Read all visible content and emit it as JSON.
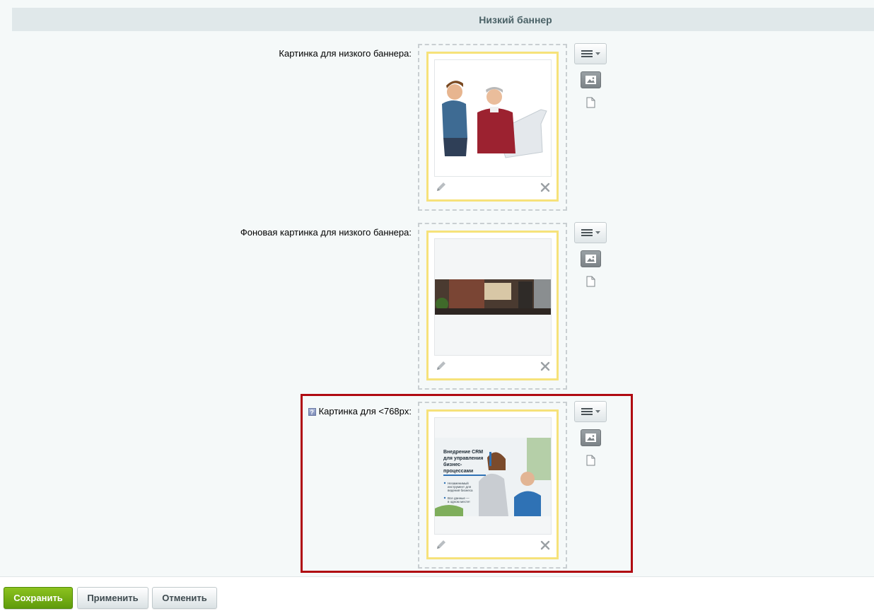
{
  "section": {
    "title": "Низкий баннер"
  },
  "fields": [
    {
      "label": "Картинка для низкого баннера:"
    },
    {
      "label": "Фоновая картинка для низкого баннера:"
    },
    {
      "label": "Картинка для <768px:",
      "help_icon_text": "?"
    }
  ],
  "promo_image": {
    "title": "Внедрение CRM для управления бизнес-процессами",
    "bullets": [
      "Незаменимый инструмент для ведения бизнеса",
      "Все данные — в одном месте!"
    ]
  },
  "footer": {
    "save_label": "Сохранить",
    "apply_label": "Применить",
    "cancel_label": "Отменить"
  },
  "colors": {
    "accent_save": "#6aab12",
    "highlight_border": "#b00a12",
    "frame_yellow": "#f6e27a",
    "header_bg": "#e0e8ea"
  }
}
